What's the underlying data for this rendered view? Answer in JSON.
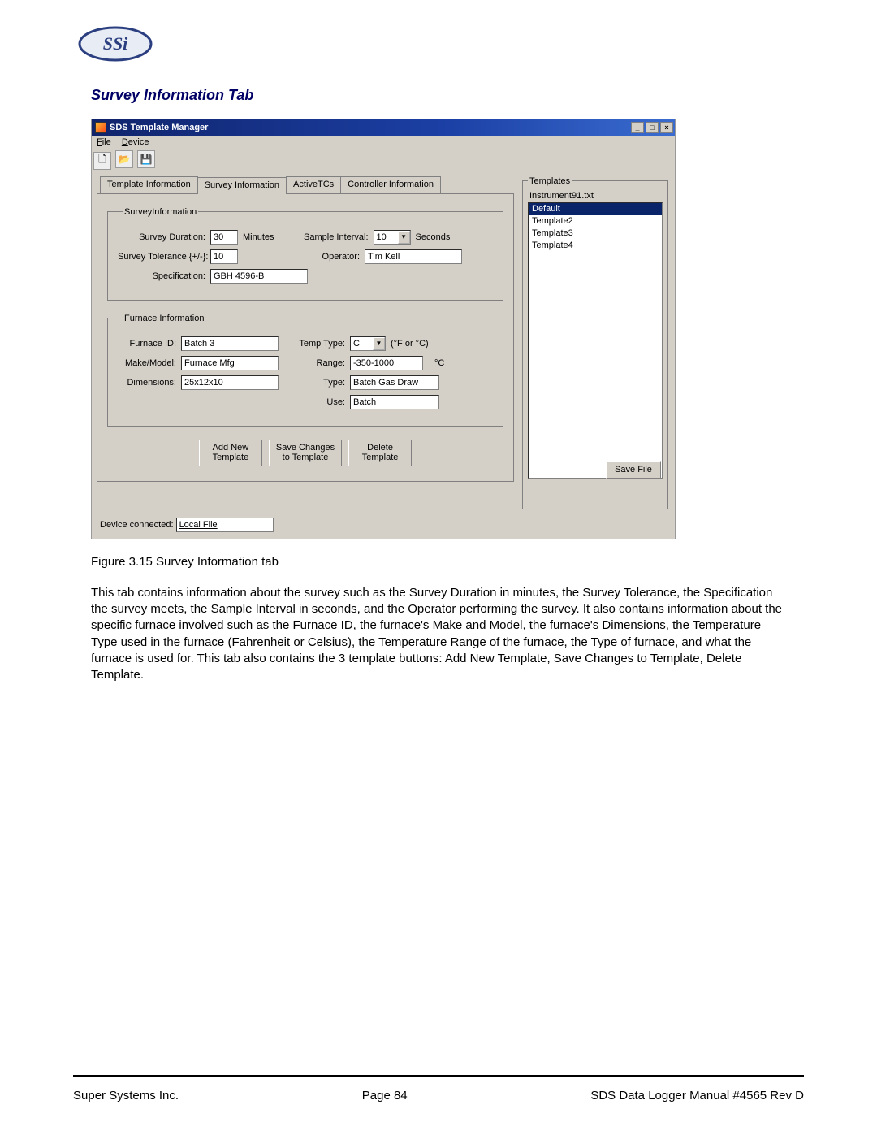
{
  "page": {
    "section_heading": "Survey Information Tab",
    "figure_caption": "Figure 3.15 Survey Information tab",
    "body": "This tab contains information about the survey such as the Survey Duration in minutes, the Survey Tolerance, the Specification the survey meets, the Sample Interval in seconds, and the Operator performing the survey.  It also contains information about the specific furnace involved such as the Furnace ID, the furnace's Make and Model, the furnace's Dimensions, the Temperature Type used in the furnace (Fahrenheit or Celsius), the Temperature Range of the furnace, the Type of furnace, and what the furnace is used for.  This tab also contains the 3 template buttons: Add New Template, Save Changes to Template, Delete Template.",
    "footer_left": "Super Systems Inc.",
    "footer_center": "Page 84",
    "footer_right": "SDS Data Logger Manual #4565 Rev D"
  },
  "window": {
    "title": "SDS Template Manager",
    "menus": {
      "file": "File",
      "device": "Device"
    },
    "tabs": {
      "template_info": "Template Information",
      "survey_info": "Survey Information",
      "active_tcs": "ActiveTCs",
      "controller_info": "Controller Information"
    },
    "survey_box": {
      "legend": "SurveyInformation",
      "duration_label": "Survey Duration:",
      "duration_value": "30",
      "minutes": "Minutes",
      "sample_interval_label": "Sample Interval:",
      "sample_interval_value": "10",
      "seconds": "Seconds",
      "tolerance_label": "Survey Tolerance  {+/-}:",
      "tolerance_value": "10",
      "operator_label": "Operator:",
      "operator_value": "Tim Kell",
      "specification_label": "Specification:",
      "specification_value": "GBH 4596-B"
    },
    "furnace_box": {
      "legend": "Furnace Information",
      "furnace_id_label": "Furnace ID:",
      "furnace_id_value": "Batch 3",
      "temp_type_label": "Temp Type:",
      "temp_type_value": "C",
      "temp_type_hint": "(°F or °C)",
      "make_model_label": "Make/Model:",
      "make_model_value": "Furnace Mfg",
      "range_label": "Range:",
      "range_value": "-350-1000",
      "range_unit": "°C",
      "dimensions_label": "Dimensions:",
      "dimensions_value": "25x12x10",
      "type_label": "Type:",
      "type_value": "Batch Gas Draw",
      "use_label": "Use:",
      "use_value": "Batch"
    },
    "buttons": {
      "add_new": "Add New\nTemplate",
      "save_changes": "Save Changes\nto Template",
      "delete": "Delete\nTemplate",
      "save_file": "Save File"
    },
    "templates": {
      "legend": "Templates",
      "file_label": "Instrument91.txt",
      "items": [
        "Default",
        "Template2",
        "Template3",
        "Template4"
      ],
      "selected_index": 0
    },
    "device": {
      "label": "Device connected:",
      "value": "Local File"
    }
  }
}
